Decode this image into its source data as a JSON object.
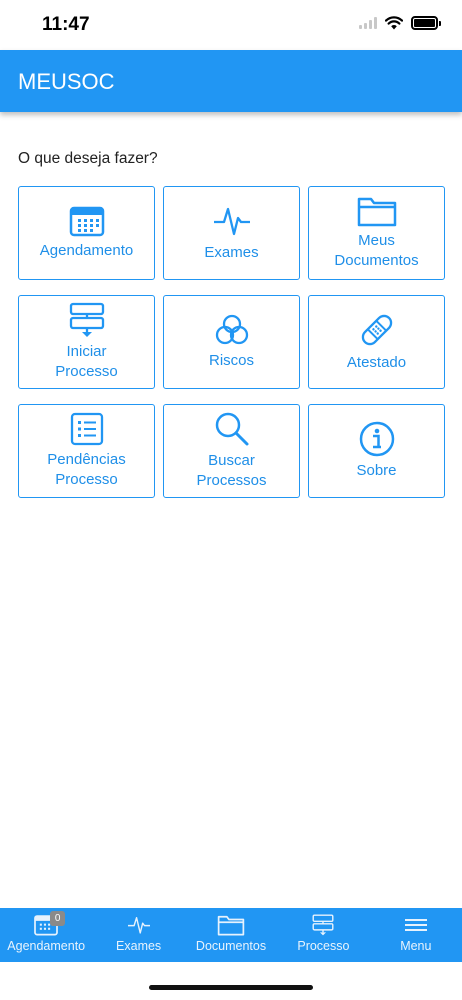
{
  "status_bar": {
    "time": "11:47"
  },
  "header": {
    "title": "MEUSOC"
  },
  "main": {
    "prompt": "O que deseja fazer?",
    "tiles": [
      {
        "label": "Agendamento",
        "icon": "calendar-icon"
      },
      {
        "label": "Exames",
        "icon": "pulse-icon"
      },
      {
        "label": "Meus\nDocumentos",
        "icon": "folder-icon"
      },
      {
        "label": "Iniciar\nProcesso",
        "icon": "process-icon"
      },
      {
        "label": "Riscos",
        "icon": "risks-icon"
      },
      {
        "label": "Atestado",
        "icon": "bandage-icon"
      },
      {
        "label": "Pendências\nProcesso",
        "icon": "list-icon"
      },
      {
        "label": "Buscar\nProcessos",
        "icon": "search-icon"
      },
      {
        "label": "Sobre",
        "icon": "info-icon"
      }
    ]
  },
  "tabbar": {
    "items": [
      {
        "label": "Agendamento",
        "icon": "calendar-icon",
        "badge": "0"
      },
      {
        "label": "Exames",
        "icon": "pulse-icon"
      },
      {
        "label": "Documentos",
        "icon": "folder-icon"
      },
      {
        "label": "Processo",
        "icon": "process-icon"
      },
      {
        "label": "Menu",
        "icon": "menu-icon"
      }
    ]
  },
  "colors": {
    "primary": "#2196f3",
    "badge": "#8a8a8a"
  }
}
